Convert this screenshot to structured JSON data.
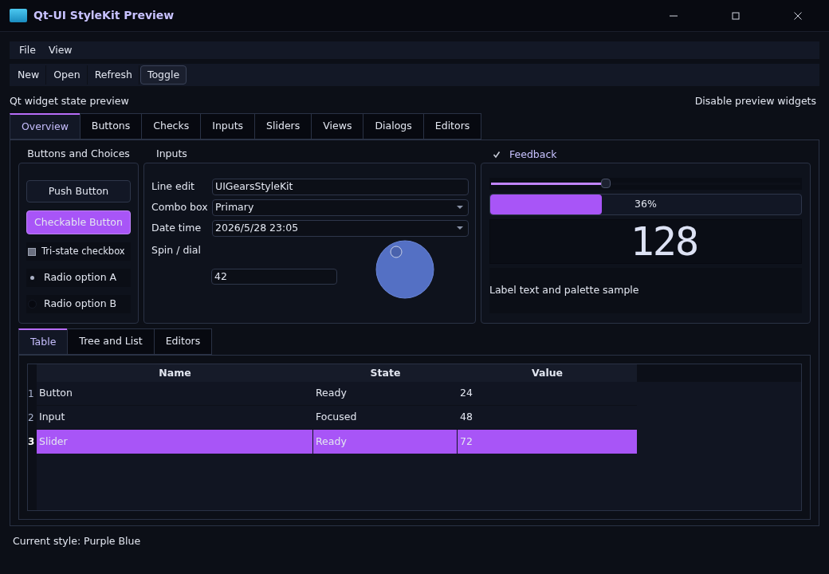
{
  "window": {
    "title": "Qt-UI StyleKit Preview"
  },
  "menu": [
    "File",
    "View"
  ],
  "toolbar": [
    {
      "label": "New",
      "checked": false
    },
    {
      "label": "Open",
      "checked": false
    },
    {
      "label": "Refresh",
      "checked": false
    },
    {
      "label": "Toggle",
      "checked": true
    }
  ],
  "header": {
    "caption": "Qt widget state preview",
    "action": "Disable preview widgets"
  },
  "tabs": [
    {
      "label": "Overview",
      "selected": true
    },
    {
      "label": "Buttons",
      "selected": false
    },
    {
      "label": "Checks",
      "selected": false
    },
    {
      "label": "Inputs",
      "selected": false
    },
    {
      "label": "Sliders",
      "selected": false
    },
    {
      "label": "Views",
      "selected": false
    },
    {
      "label": "Dialogs",
      "selected": false
    },
    {
      "label": "Editors",
      "selected": false
    }
  ],
  "buttons_group": {
    "title": "Buttons and Choices",
    "push": "Push Button",
    "checkable": {
      "label": "Checkable Button",
      "checked": true
    },
    "tristate": {
      "label": "Tri-state checkbox",
      "partial": true
    },
    "radios": [
      {
        "label": "Radio option A",
        "selected": true
      },
      {
        "label": "Radio option B",
        "selected": false
      }
    ]
  },
  "inputs_group": {
    "title": "Inputs",
    "line_edit": {
      "label": "Line edit",
      "value": "UIGearsStyleKit"
    },
    "combo": {
      "label": "Combo box",
      "value": "Primary"
    },
    "date": {
      "label": "Date time",
      "value": "2026/5/28 23:05"
    },
    "spin": {
      "label": "Spin / dial",
      "value": "42"
    }
  },
  "feedback_group": {
    "title": "Feedback",
    "checked": true,
    "slider": {
      "level": 0.37
    },
    "progress": {
      "level": 0.36,
      "text": "36%"
    },
    "lcd": "128",
    "label": "Label text and palette sample"
  },
  "view_tabs": [
    {
      "label": "Table",
      "selected": true
    },
    {
      "label": "Tree and List",
      "selected": false
    },
    {
      "label": "Editors",
      "selected": false
    }
  ],
  "table": {
    "columns": [
      "Name",
      "State",
      "Value"
    ],
    "rows": [
      {
        "index": "1",
        "cells": [
          "Button",
          "Ready",
          "24"
        ],
        "selected": false
      },
      {
        "index": "2",
        "cells": [
          "Input",
          "Focused",
          "48"
        ],
        "selected": false
      },
      {
        "index": "3",
        "cells": [
          "Slider",
          "Ready",
          "72"
        ],
        "selected": true
      }
    ]
  },
  "status_bar": "Current style: Purple Blue"
}
